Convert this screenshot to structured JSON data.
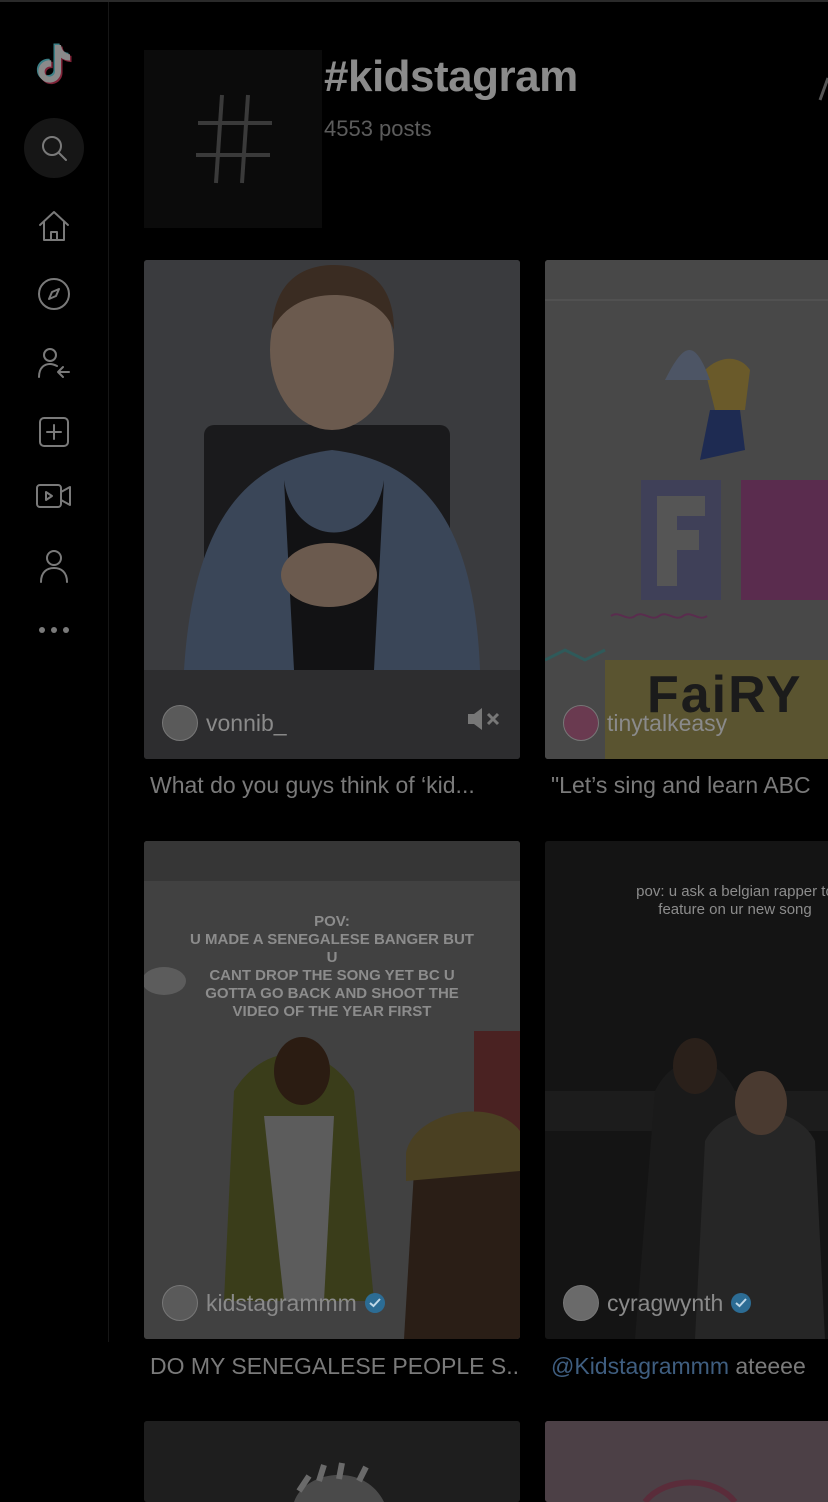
{
  "header": {
    "hashtag": "#kidstagram",
    "post_count": "4553 posts"
  },
  "sidebar": {
    "items": [
      {
        "icon": "tiktok-logo-icon"
      },
      {
        "icon": "search-icon"
      },
      {
        "icon": "home-icon"
      },
      {
        "icon": "explore-compass-icon"
      },
      {
        "icon": "following-icon"
      },
      {
        "icon": "upload-icon"
      },
      {
        "icon": "live-icon"
      },
      {
        "icon": "profile-icon"
      },
      {
        "icon": "more-icon"
      }
    ]
  },
  "videos": [
    {
      "author": "vonnib_",
      "caption": "What do you guys think of ‘kid...",
      "verified": false,
      "muted": true
    },
    {
      "author": "tinytalkeasy",
      "caption": "\"Let’s sing and learn ABC",
      "verified": false,
      "overlay_letters": "Ff",
      "overlay_word": "FaiRY"
    },
    {
      "author": "kidstagrammm",
      "caption": "DO MY SENEGALESE PEOPLE S...",
      "verified": true,
      "overlay_text": "POV:\nU MADE A SENEGALESE BANGER BUT U\nCANT DROP THE SONG YET BC U\nGOTTA GO BACK AND SHOOT THE\nVIDEO OF THE YEAR FIRST"
    },
    {
      "author": "cyragwynth",
      "caption_mention": "@Kidstagrammm",
      "caption_rest": " ateeee",
      "verified": true,
      "overlay_text": "pov: u ask a belgian rapper to\nfeature on ur new song"
    }
  ]
}
